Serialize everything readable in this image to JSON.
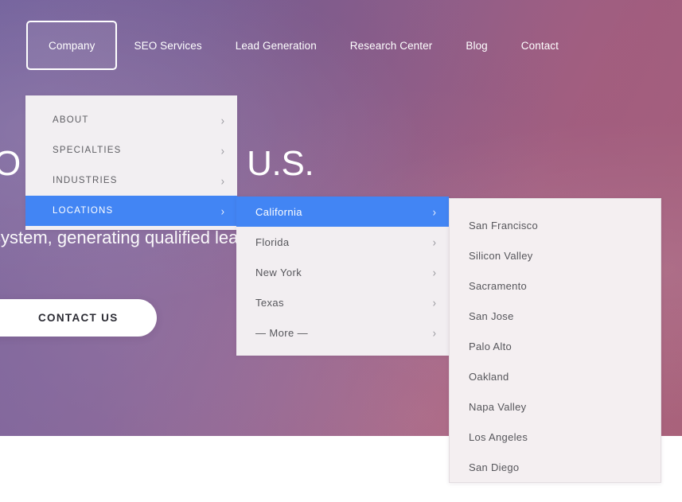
{
  "topnav": {
    "items": [
      {
        "label": "Company",
        "active": true
      },
      {
        "label": "SEO Services",
        "active": false
      },
      {
        "label": "Lead Generation",
        "active": false
      },
      {
        "label": "Research Center",
        "active": false
      },
      {
        "label": "Blog",
        "active": false
      },
      {
        "label": "Contact",
        "active": false
      }
    ]
  },
  "hero": {
    "title": "O Agency in the U.S.",
    "subtitle": "system, generating qualified leads and ROI for years to come.",
    "cta_label": "CONTACT US"
  },
  "menu": {
    "chevron": "›",
    "panel1": {
      "items": [
        {
          "label": "ABOUT",
          "highlight": false,
          "chevron": true
        },
        {
          "label": "SPECIALTIES",
          "highlight": false,
          "chevron": true
        },
        {
          "label": "INDUSTRIES",
          "highlight": false,
          "chevron": true
        },
        {
          "label": "LOCATIONS",
          "highlight": true,
          "chevron": true
        }
      ]
    },
    "panel2": {
      "items": [
        {
          "label": "California",
          "highlight": true,
          "chevron": true
        },
        {
          "label": "Florida",
          "highlight": false,
          "chevron": true
        },
        {
          "label": "New York",
          "highlight": false,
          "chevron": true
        },
        {
          "label": "Texas",
          "highlight": false,
          "chevron": true
        },
        {
          "label": "— More —",
          "highlight": false,
          "chevron": true
        }
      ]
    },
    "panel3": {
      "items": [
        {
          "label": "San Francisco",
          "highlight": false,
          "chevron": false
        },
        {
          "label": "Silicon Valley",
          "highlight": false,
          "chevron": false
        },
        {
          "label": "Sacramento",
          "highlight": false,
          "chevron": false
        },
        {
          "label": "San Jose",
          "highlight": false,
          "chevron": false
        },
        {
          "label": "Palo Alto",
          "highlight": false,
          "chevron": false
        },
        {
          "label": "Oakland",
          "highlight": false,
          "chevron": false
        },
        {
          "label": "Napa Valley",
          "highlight": false,
          "chevron": false
        },
        {
          "label": "Los Angeles",
          "highlight": false,
          "chevron": false
        },
        {
          "label": "San Diego",
          "highlight": false,
          "chevron": false
        }
      ]
    }
  },
  "colors": {
    "highlight_blue": "#4285f4",
    "panel_bg": "#f2eff2",
    "hero_purple": "#72619c",
    "hero_rose": "#a65f78",
    "cta_bg": "#ffffff"
  }
}
